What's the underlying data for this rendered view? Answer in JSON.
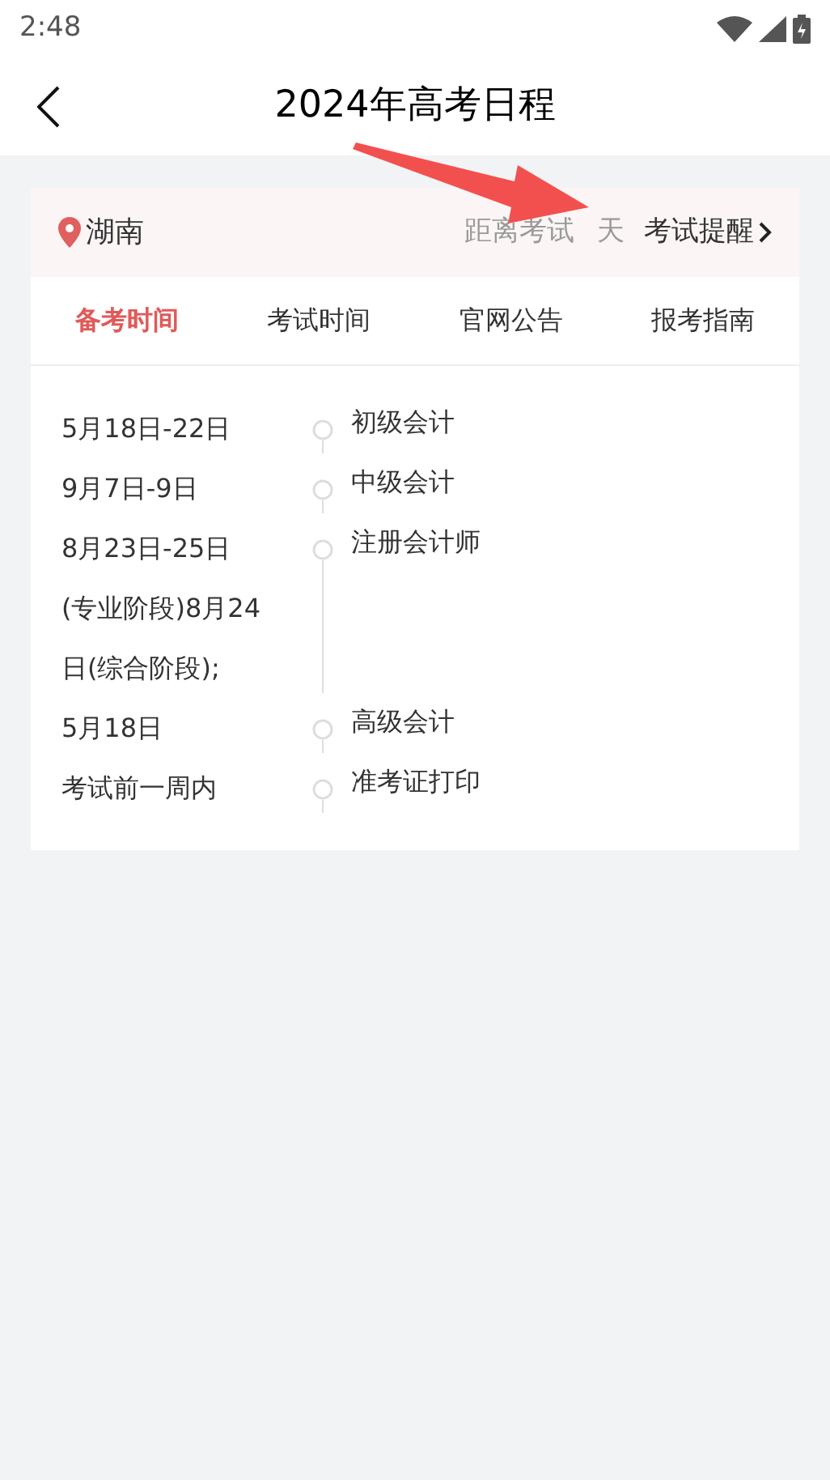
{
  "status_bar": {
    "time": "2:48"
  },
  "header": {
    "title": "2024年高考日程"
  },
  "info_bar": {
    "location": "湖南",
    "countdown_label": "距离考试",
    "countdown_unit": "天",
    "reminder": "考试提醒"
  },
  "tabs": [
    {
      "label": "备考时间",
      "selected": true
    },
    {
      "label": "考试时间",
      "selected": false
    },
    {
      "label": "官网公告",
      "selected": false
    },
    {
      "label": "报考指南",
      "selected": false
    }
  ],
  "timeline": [
    {
      "date": "5月18日-22日",
      "event": "初级会计"
    },
    {
      "date": "9月7日-9日",
      "event": "中级会计"
    },
    {
      "date": "8月23日-25日(专业阶段)8月24日(综合阶段);",
      "event": "注册会计师"
    },
    {
      "date": "5月18日",
      "event": "高级会计"
    },
    {
      "date": "考试前一周内",
      "event": "准考证打印"
    }
  ]
}
